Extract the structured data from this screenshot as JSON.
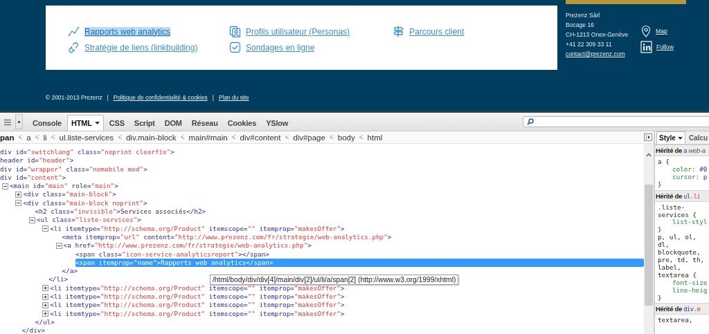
{
  "site": {
    "services": [
      {
        "label": "Rapports web analytics",
        "highlighted": true
      },
      {
        "label": "Profils utilisateur (Personas)",
        "highlighted": false
      },
      {
        "label": "Parcours client",
        "highlighted": false
      },
      {
        "label": "Stratégie de liens (linkbuilding)",
        "highlighted": false
      },
      {
        "label": "Sondages en ligne",
        "highlighted": false
      }
    ],
    "contact": {
      "lines": [
        "Prezenz Sàrl",
        "Bocage 16",
        "CH-1213 Onex-Genève",
        "+41 22 309 33 11"
      ],
      "email": "contact@prezenz.com",
      "links": [
        "Map",
        "Follow"
      ]
    },
    "footer": [
      {
        "kind": "text",
        "text": "© 2001-2013 Prezenz"
      },
      {
        "kind": "separator",
        "text": "|"
      },
      {
        "kind": "link",
        "text": "Politique de confidentialité & cookies"
      },
      {
        "kind": "separator",
        "text": "|"
      },
      {
        "kind": "link",
        "text": "Plan du site"
      }
    ]
  },
  "devtools": {
    "tabs": [
      {
        "label": "Console",
        "selected": false,
        "dropdown": false
      },
      {
        "label": "HTML",
        "selected": true,
        "dropdown": true
      },
      {
        "label": "CSS",
        "selected": false,
        "dropdown": false
      },
      {
        "label": "Script",
        "selected": false,
        "dropdown": false
      },
      {
        "label": "DOM",
        "selected": false,
        "dropdown": false
      },
      {
        "label": "Réseau",
        "selected": false,
        "dropdown": false
      },
      {
        "label": "Cookies",
        "selected": false,
        "dropdown": false
      },
      {
        "label": "YSlow",
        "selected": false,
        "dropdown": false
      }
    ],
    "breadcrumb": [
      {
        "label": "pan",
        "selected": true
      },
      {
        "separator": "<",
        "label": "a",
        "selected": false
      },
      {
        "separator": "<",
        "label": "li",
        "selected": false
      },
      {
        "separator": "<",
        "label": "ul.liste-services",
        "selected": false
      },
      {
        "separator": "<",
        "label": "div.main-block",
        "selected": false
      },
      {
        "separator": "<",
        "label": "main#main",
        "selected": false
      },
      {
        "separator": "<",
        "label": "div#content",
        "selected": false
      },
      {
        "separator": "<",
        "label": "div#page",
        "selected": false
      },
      {
        "separator": "<",
        "label": "body",
        "selected": false
      },
      {
        "separator": "<",
        "label": "html",
        "selected": false
      }
    ],
    "tree": [
      {
        "markup": "div id=\"switchlang\" class=\"noprint clearfix\">",
        "selected": false
      },
      {
        "markup": "header id=\"header\">",
        "selected": false
      },
      {
        "markup": "div id=\"wrapper\" class=\"nomobile mod\">",
        "selected": false
      },
      {
        "markup": "div id=\"content\">",
        "selected": false
      },
      {
        "markup": "<main id=\"main\" role=\"main\">",
        "selected": false,
        "expanded": true,
        "children": [
          {
            "markup": "<div class=\"main-block\">",
            "selected": false,
            "expanded": false
          },
          {
            "markup": "<div class=\"main-block noprint\">",
            "selected": false,
            "expanded": true,
            "closing": "</div>",
            "children": [
              {
                "markup": "<h2 class=\"invisible\">Services associés</h2>",
                "selected": false
              },
              {
                "markup": "<ul class=\"liste-services\">",
                "selected": false,
                "expanded": true,
                "closing": "</ul>",
                "children": [
                  {
                    "markup": "<li itemtype=\"http://schema.org/Product\" itemscope=\"\" itemprop=\"makesOffer\">",
                    "selected": false,
                    "expanded": true,
                    "closing": "</li>",
                    "children": [
                      {
                        "markup": "<meta itemprop=\"url\" content=\"http://www.prezenz.com/fr/strategie/web-analytics.php\">",
                        "selected": false
                      },
                      {
                        "markup": "<a href=\"http://www.prezenz.com/fr/strategie/web-analytics.php\">",
                        "selected": false,
                        "expanded": true,
                        "closing": "</a>",
                        "children": [
                          {
                            "markup": "<span class=\"icon-service-analyticsreport\"></span>",
                            "selected": false
                          },
                          {
                            "markup": "<span itemprop=\"name\">Rapports web analytics</span>",
                            "selected": true
                          }
                        ]
                      }
                    ]
                  },
                  {
                    "markup": "<li itemtype=\"http://schema.org/Product\" itemscope=\"\" itemprop=\"makesOffer\">",
                    "selected": false,
                    "expanded": false
                  },
                  {
                    "markup": "<li itemtype=\"http://schema.org/Product\" itemscope=\"\" itemprop=\"makesOffer\">",
                    "selected": false,
                    "expanded": false
                  },
                  {
                    "markup": "<li itemtype=\"http://schema.org/Product\" itemscope=\"\" itemprop=\"makesOffer\">",
                    "selected": false,
                    "expanded": false
                  },
                  {
                    "markup": "<li itemtype=\"http://schema.org/Product\" itemscope=\"\" itemprop=\"makesOffer\">",
                    "selected": false,
                    "expanded": false
                  }
                ]
              }
            ]
          }
        ]
      }
    ],
    "tooltip": "/html/body/div/div[4]/main/div[2]/ul/li/a/span[2] (http://www.w3.org/1999/xhtml)",
    "side_tabs": [
      {
        "label": "Style",
        "selected": true,
        "dropdown": true
      },
      {
        "label": "Calcu",
        "selected": false,
        "dropdown": false
      }
    ],
    "style_sections": [
      {
        "heading": "Hérité de",
        "source": "a",
        "source_note": "web-a",
        "lines": [
          {
            "kind": "selector",
            "text": "a {"
          },
          {
            "kind": "declaration",
            "text": "color: #0"
          },
          {
            "kind": "declaration",
            "text": "cursor: p"
          },
          {
            "kind": "brace",
            "text": "}"
          }
        ]
      },
      {
        "heading": "Hérité de",
        "source": "ul.li",
        "lines": [
          {
            "kind": "selector",
            "text": ".liste-"
          },
          {
            "kind": "selector",
            "text": "services {"
          },
          {
            "kind": "declaration",
            "text": "list-styl"
          },
          {
            "kind": "brace",
            "text": "}"
          },
          {
            "kind": "selector",
            "text": "p, ul, ol,"
          },
          {
            "kind": "selector",
            "text": "dl,"
          },
          {
            "kind": "selector",
            "text": "blockquote,"
          },
          {
            "kind": "selector",
            "text": "pre, td, th,"
          },
          {
            "kind": "selector",
            "text": "label,"
          },
          {
            "kind": "selector",
            "text": "textarea {"
          },
          {
            "kind": "declaration",
            "text": "font-size"
          },
          {
            "kind": "declaration",
            "text": "line-heig"
          },
          {
            "kind": "brace",
            "text": "}"
          }
        ]
      },
      {
        "heading": "Hérité de",
        "source": "div.m",
        "lines": [
          {
            "kind": "selector",
            "text": "textarea,"
          }
        ]
      }
    ]
  }
}
